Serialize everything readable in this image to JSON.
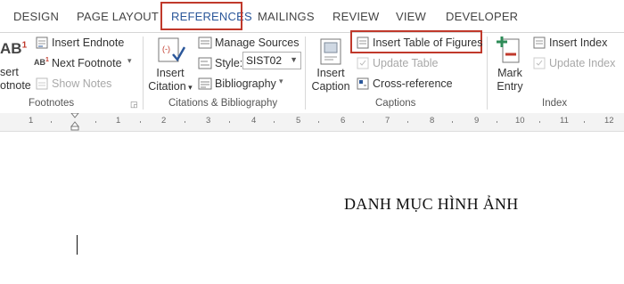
{
  "tabs": [
    "DESIGN",
    "PAGE LAYOUT",
    "REFERENCES",
    "MAILINGS",
    "REVIEW",
    "VIEW",
    "DEVELOPER"
  ],
  "footnotes": {
    "insert_endnote": "Insert Endnote",
    "next_footnote": "Next Footnote",
    "show_notes": "Show Notes",
    "insert_footnote_line1": "sert",
    "insert_footnote_line2": "otnote",
    "big_icon_text": "AB",
    "group_label": "Footnotes"
  },
  "citations": {
    "insert_citation_line1": "Insert",
    "insert_citation_line2": "Citation",
    "manage_sources": "Manage Sources",
    "style_label": "Style:",
    "style_value": "SIST02",
    "bibliography": "Bibliography",
    "group_label": "Citations & Bibliography"
  },
  "captions": {
    "insert_caption_line1": "Insert",
    "insert_caption_line2": "Caption",
    "insert_table_of_figures": "Insert Table of Figures",
    "update_table": "Update Table",
    "cross_reference": "Cross-reference",
    "group_label": "Captions"
  },
  "index": {
    "mark_entry_line1": "Mark",
    "mark_entry_line2": "Entry",
    "insert_index": "Insert Index",
    "update_index": "Update Index",
    "group_label": "Index"
  },
  "ruler": {
    "numbers": [
      "1",
      "1",
      "2",
      "3",
      "4",
      "5",
      "6",
      "7",
      "8",
      "9",
      "10",
      "11",
      "12"
    ]
  },
  "document": {
    "heading": "DANH MỤC HÌNH ẢNH"
  },
  "colors": {
    "active_tab": "#2b579a",
    "highlight": "#c0392b"
  }
}
